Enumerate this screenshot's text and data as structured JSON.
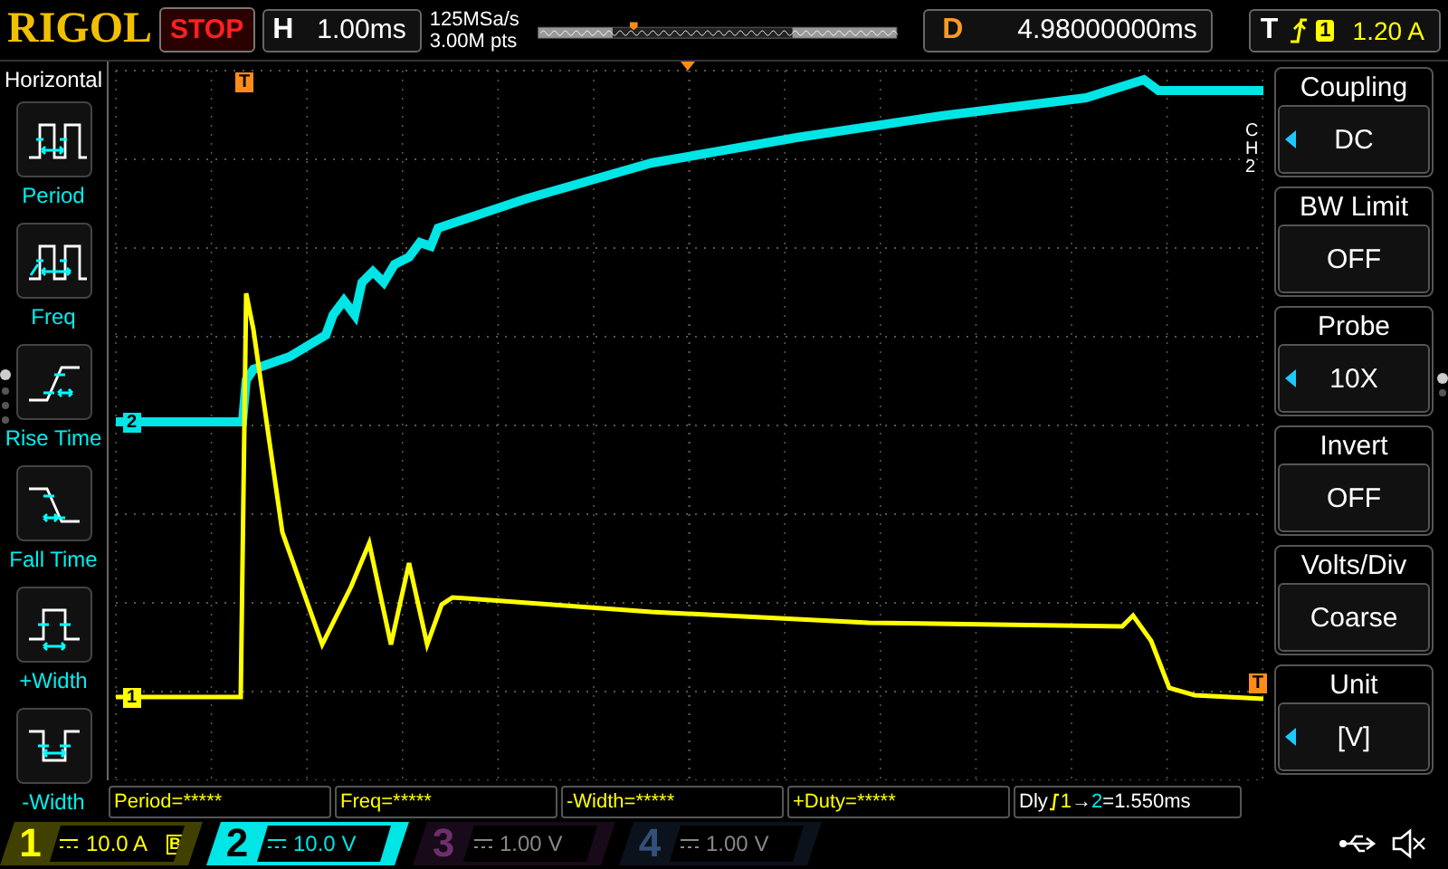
{
  "top_bar": {
    "brand": "RIGOL",
    "run_state": "STOP",
    "timebase": {
      "label": "H",
      "value": "1.00ms"
    },
    "sample_rate": "125MSa/s",
    "memory_depth": "3.00M pts",
    "delay": {
      "label": "D",
      "value": "4.98000000ms"
    },
    "trigger": {
      "label": "T",
      "source": "1",
      "level": "1.20 A"
    }
  },
  "left_menu": {
    "title": "Horizontal",
    "items": [
      {
        "kind": "period",
        "label": "Period"
      },
      {
        "kind": "freq",
        "label": "Freq"
      },
      {
        "kind": "rise",
        "label": "Rise Time"
      },
      {
        "kind": "fall",
        "label": "Fall Time"
      },
      {
        "kind": "pwidth",
        "label": "+Width"
      },
      {
        "kind": "nwidth",
        "label": "-Width"
      }
    ],
    "pages": [
      {
        "selected": true
      },
      {
        "selected": false
      },
      {
        "selected": false
      },
      {
        "selected": false
      }
    ]
  },
  "graticule": {
    "trace_markers": [
      {
        "label": "2",
        "color": "#00e5e5"
      },
      {
        "label": "1",
        "color": "#ffff00"
      }
    ],
    "trigger_marker": "T",
    "trigger_level_marker": "T"
  },
  "right_menu": {
    "channel_tag": "CH2",
    "items": [
      {
        "title": "Coupling",
        "value": "DC",
        "adjustable": true
      },
      {
        "title": "BW Limit",
        "value": "OFF",
        "adjustable": false
      },
      {
        "title": "Probe",
        "value": "10X",
        "adjustable": true
      },
      {
        "title": "Invert",
        "value": "OFF",
        "adjustable": false
      },
      {
        "title": "Volts/Div",
        "value": "Coarse",
        "adjustable": false
      },
      {
        "title": "Unit",
        "value": "[V]",
        "adjustable": true
      }
    ],
    "pages": [
      {
        "selected": true
      },
      {
        "selected": false
      }
    ]
  },
  "measurements": [
    "Period=*****",
    "Freq=*****",
    "-Width=*****",
    "+Duty=*****"
  ],
  "delay_measurement": {
    "label": "Dly",
    "from": "1",
    "arrow": "→",
    "to": "2",
    "value": "=1.550ms"
  },
  "channels": [
    {
      "number": "1",
      "scale": "10.0 A",
      "on": true,
      "selected": false,
      "bw_mark": "B",
      "color": "#ffff00"
    },
    {
      "number": "2",
      "scale": "10.0 V",
      "on": true,
      "selected": true,
      "color": "#00e5e5"
    },
    {
      "number": "3",
      "scale": "1.00 V",
      "on": false,
      "selected": false,
      "color": "#6e2f6e"
    },
    {
      "number": "4",
      "scale": "1.00 V",
      "on": false,
      "selected": false,
      "color": "#34507a"
    }
  ]
}
